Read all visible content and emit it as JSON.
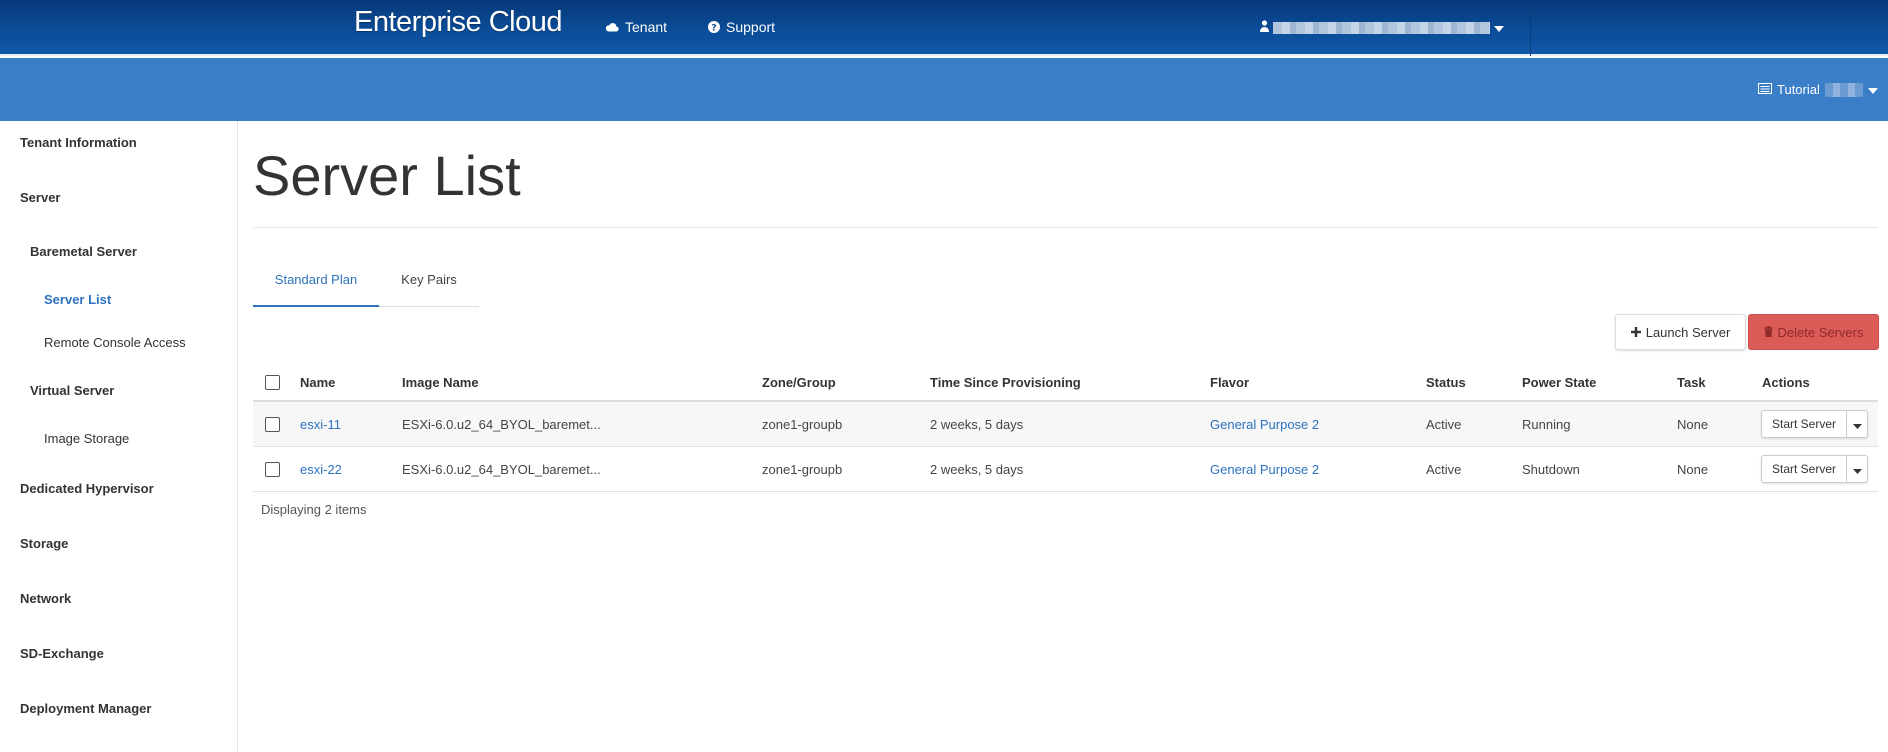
{
  "header": {
    "brand": "Enterprise Cloud",
    "nav": [
      {
        "label": "Tenant",
        "icon": "cloud-icon"
      },
      {
        "label": "Support",
        "icon": "question-circle-icon"
      }
    ]
  },
  "subheader": {
    "project_label": "Tutorial"
  },
  "sidebar": {
    "items": [
      {
        "label": "Tenant Information",
        "level": 1
      },
      {
        "label": "Server",
        "level": 1
      },
      {
        "label": "Baremetal Server",
        "level": 2
      },
      {
        "label": "Server List",
        "level": 3,
        "active": true
      },
      {
        "label": "Remote Console Access",
        "level": 3
      },
      {
        "label": "Virtual Server",
        "level": 2
      },
      {
        "label": "Image Storage",
        "level": 3
      },
      {
        "label": "Dedicated Hypervisor",
        "level": 1
      },
      {
        "label": "Storage",
        "level": 1
      },
      {
        "label": "Network",
        "level": 1
      },
      {
        "label": "SD-Exchange",
        "level": 1
      },
      {
        "label": "Deployment Manager",
        "level": 1
      }
    ]
  },
  "main": {
    "title": "Server List",
    "tabs": [
      {
        "label": "Standard Plan",
        "active": true
      },
      {
        "label": "Key Pairs",
        "active": false
      }
    ],
    "actions": {
      "launch_label": "Launch Server",
      "delete_label": "Delete Servers"
    },
    "table": {
      "columns": [
        "Name",
        "Image Name",
        "Zone/Group",
        "Time Since Provisioning",
        "Flavor",
        "Status",
        "Power State",
        "Task",
        "Actions"
      ],
      "rows": [
        {
          "name": "esxi-11",
          "image": "ESXi-6.0.u2_64_BYOL_baremet...",
          "zone": "zone1-groupb",
          "time": "2 weeks, 5 days",
          "flavor": "General Purpose 2",
          "status": "Active",
          "power": "Running",
          "task": "None",
          "action": "Start Server"
        },
        {
          "name": "esxi-22",
          "image": "ESXi-6.0.u2_64_BYOL_baremet...",
          "zone": "zone1-groupb",
          "time": "2 weeks, 5 days",
          "flavor": "General Purpose 2",
          "status": "Active",
          "power": "Shutdown",
          "task": "None",
          "action": "Start Server"
        }
      ]
    },
    "footer": "Displaying 2 items"
  },
  "colors": {
    "topbar": "#0a4c97",
    "subbar": "#3a7ec8",
    "accent": "#2d72bf",
    "danger": "#d9534f"
  }
}
